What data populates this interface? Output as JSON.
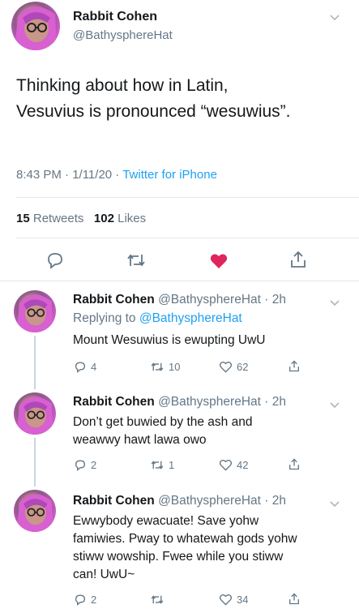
{
  "colors": {
    "accent": "#1da1f2",
    "like_red": "#e0245e",
    "grey": "#657786",
    "divider": "#e1e8ed"
  },
  "main_tweet": {
    "author_name": "Rabbit Cohen",
    "author_handle": "@BathysphereHat",
    "text_line1": "Thinking about how in Latin,",
    "text_line2": "Vesuvius is pronounced “wesuwius”.",
    "time_date": "8:43 PM · 1/11/20 · ",
    "source": "Twitter for iPhone",
    "retweets_count": "15",
    "retweets_label": "Retweets",
    "likes_count": "102",
    "likes_label": "Likes"
  },
  "replies": [
    {
      "name": "Rabbit Cohen",
      "handle_time": "@BathysphereHat · 2h",
      "replying_prefix": "Replying to ",
      "replying_handle": "@BathysphereHat",
      "lines": [
        "Mount Wesuwius is ewupting UwU"
      ],
      "reply_count": "4",
      "retweet_count": "10",
      "like_count": "62"
    },
    {
      "name": "Rabbit Cohen",
      "handle_time": "@BathysphereHat · 2h",
      "lines": [
        "Don’t get buwied by the ash and",
        "weawwy hawt lawa owo"
      ],
      "reply_count": "2",
      "retweet_count": "1",
      "like_count": "42"
    },
    {
      "name": "Rabbit Cohen",
      "handle_time": "@BathysphereHat · 2h",
      "lines": [
        "Ewwybody ewacuate! Save yohw",
        "famiwies. Pway to whatewah gods yohw",
        "stiww wowship. Fwee while you stiww",
        "can! UwU~"
      ],
      "reply_count": "2",
      "retweet_count": "",
      "like_count": "34"
    }
  ]
}
